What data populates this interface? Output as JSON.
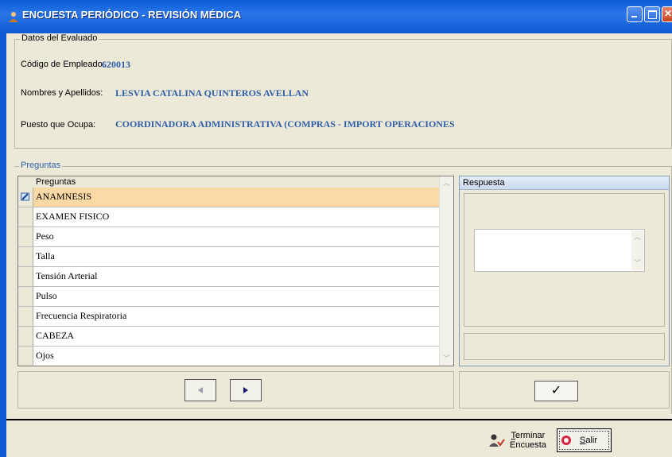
{
  "window": {
    "title": "ENCUESTA PERIÓDICO - REVISIÓN MÉDICA",
    "icon": "person-icon",
    "title_color": "#0a5bd8"
  },
  "evaluado": {
    "legend": "Datos del Evaluado",
    "codigo_label": "Código de Empleado:",
    "codigo_value": "620013",
    "nombres_label": "Nombres y Apellidos:",
    "nombres_value": "LESVIA CATALINA QUINTEROS  AVELLAN",
    "puesto_label": "Puesto que Ocupa:",
    "puesto_value": "COORDINADORA ADMINISTRATIVA (COMPRAS - IMPORT OPERACIONES",
    "value_color": "#2f5fa8"
  },
  "preguntas": {
    "legend": "Preguntas",
    "column_header": "Preguntas",
    "rows": [
      "ANAMNESIS",
      "EXAMEN FISICO",
      "Peso",
      "Talla",
      "Tensión Arterial",
      "Pulso",
      "Frecuencia Respiratoria",
      "CABEZA",
      "Ojos"
    ],
    "selected_index": 0,
    "selected_color": "#fbd9a5"
  },
  "respuesta": {
    "header": "Respuesta",
    "value": ""
  },
  "nav": {
    "prev_icon": "triangle-left-icon",
    "next_icon": "triangle-right-icon",
    "confirm_icon": "checkmark-icon",
    "confirm_glyph": "✓"
  },
  "footer": {
    "terminar_line1": "Terminar",
    "terminar_line2": "Encuesta",
    "salir_label": "Salir"
  }
}
